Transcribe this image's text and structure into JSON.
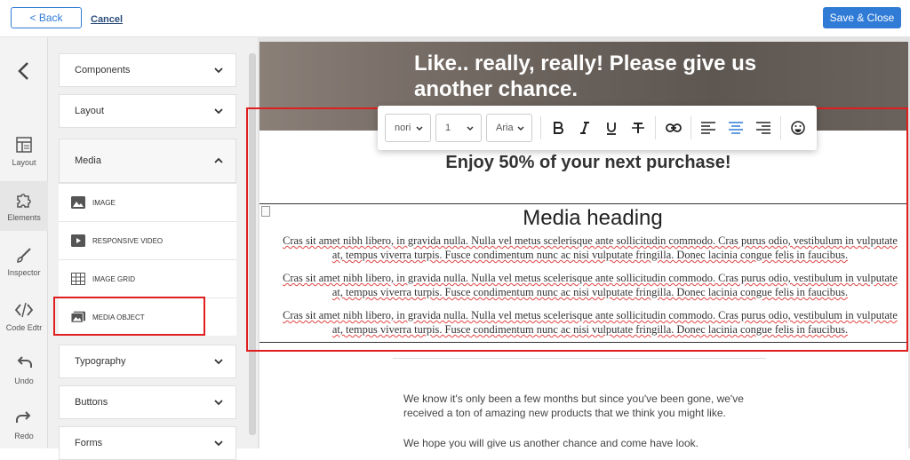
{
  "topbar": {
    "back_label": "< Back",
    "cancel_label": "Cancel",
    "save_label": "Save & Close"
  },
  "rail": {
    "items": [
      {
        "label": "Layout",
        "icon": "layout-icon"
      },
      {
        "label": "Elements",
        "icon": "puzzle-icon"
      },
      {
        "label": "Inspector",
        "icon": "brush-icon"
      },
      {
        "label": "Code Edtr",
        "icon": "code-icon"
      },
      {
        "label": "Undo",
        "icon": "undo-icon"
      },
      {
        "label": "Redo",
        "icon": "redo-icon"
      }
    ]
  },
  "panel": {
    "sections": {
      "components": "Components",
      "layout": "Layout",
      "media": "Media",
      "typography": "Typography",
      "buttons": "Buttons",
      "forms": "Forms"
    },
    "media_items": [
      {
        "label": "IMAGE",
        "icon": "image-icon"
      },
      {
        "label": "RESPONSIVE VIDEO",
        "icon": "video-icon"
      },
      {
        "label": "IMAGE GRID",
        "icon": "grid-icon"
      },
      {
        "label": "MEDIA OBJECT",
        "icon": "media-object-icon"
      }
    ]
  },
  "toolbar": {
    "font_style": "nori",
    "font_size": "1",
    "font_family": "Aria"
  },
  "email": {
    "hero_title": "Like.. really, really! Please give us another chance.",
    "subhead": "Enjoy 50% of your next purchase!",
    "media_heading": "Media heading",
    "paragraphs": [
      "Cras sit amet nibh libero, in gravida nulla. Nulla vel metus scelerisque ante sollicitudin commodo. Cras purus odio, vestibulum in vulputate at, tempus viverra turpis. Fusce condimentum nunc ac nisi vulputate fringilla. Donec lacinia congue felis in faucibus.",
      "Cras sit amet nibh libero, in gravida nulla. Nulla vel metus scelerisque ante sollicitudin commodo. Cras purus odio, vestibulum in vulputate at, tempus viverra turpis. Fusce condimentum nunc ac nisi vulputate fringilla. Donec lacinia congue felis in faucibus.",
      "Cras sit amet nibh libero, in gravida nulla. Nulla vel metus scelerisque ante sollicitudin commodo. Cras purus odio, vestibulum in vulputate at, tempus viverra turpis. Fusce condimentum nunc ac nisi vulputate fringilla. Donec lacinia congue felis in faucibus."
    ],
    "body_1": "We know it's only been a few months but since you've been gone, we've received a ton of amazing new products that we think you might like.",
    "body_2": "We hope you will give us another chance and come have look."
  },
  "colors": {
    "accent": "#2f7bd6",
    "highlight": "#e01e1e"
  }
}
